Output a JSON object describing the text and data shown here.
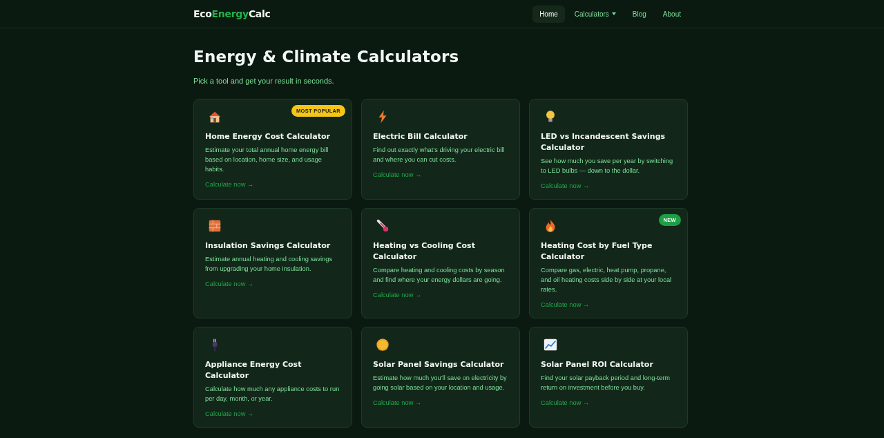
{
  "header": {
    "logo": [
      {
        "text": "Eco",
        "accent": false
      },
      {
        "text": "Energy",
        "accent": true
      },
      {
        "text": "Calc",
        "accent": false
      }
    ],
    "nav": [
      {
        "label": "Home",
        "selected": true,
        "dropdown": false
      },
      {
        "label": "Calculators",
        "selected": false,
        "dropdown": true
      },
      {
        "label": "Blog",
        "selected": false,
        "dropdown": false
      },
      {
        "label": "About",
        "selected": false,
        "dropdown": false
      }
    ]
  },
  "hero": {
    "title": "Energy & Climate Calculators",
    "subtitle": "Pick a tool and get your result in seconds."
  },
  "cards": [
    {
      "kind": "house",
      "title": "Home Energy Cost Calculator",
      "description": "Estimate your total annual home energy bill based on location, home size, and usage habits.",
      "link": "Calculate now →",
      "badge": {
        "text": "MOST POPULAR",
        "kind": "popular"
      }
    },
    {
      "kind": "bolt",
      "title": "Electric Bill Calculator",
      "description": "Find out exactly what’s driving your electric bill and where you can cut costs.",
      "link": "Calculate now →"
    },
    {
      "kind": "bulb",
      "title": "LED vs Incandescent Savings Calculator",
      "description": "See how much you save per year by switching to LED bulbs — down to the dollar.",
      "link": "Calculate now →"
    },
    {
      "kind": "brick",
      "title": "Insulation Savings Calculator",
      "description": "Estimate annual heating and cooling savings from upgrading your home insulation.",
      "link": "Calculate now →"
    },
    {
      "kind": "thermometer",
      "title": "Heating vs Cooling Cost Calculator",
      "description": "Compare heating and cooling costs by season and find where your energy dollars are going.",
      "link": "Calculate now →"
    },
    {
      "kind": "flame",
      "title": "Heating Cost by Fuel Type Calculator",
      "description": "Compare gas, electric, heat pump, propane, and oil heating costs side by side at your local rates.",
      "link": "Calculate now →",
      "badge": {
        "text": "NEW",
        "kind": "new"
      }
    },
    {
      "kind": "plug",
      "title": "Appliance Energy Cost Calculator",
      "description": "Calculate how much any appliance costs to run per day, month, or year.",
      "link": "Calculate now →"
    },
    {
      "kind": "sun",
      "title": "Solar Panel Savings Calculator",
      "description": "Estimate how much you’ll save on electricity by going solar based on your location and usage.",
      "link": "Calculate now →"
    },
    {
      "kind": "chart",
      "title": "Solar Panel ROI Calculator",
      "description": "Find your solar payback period and long-term return on investment before you buy.",
      "link": "Calculate now →"
    }
  ]
}
